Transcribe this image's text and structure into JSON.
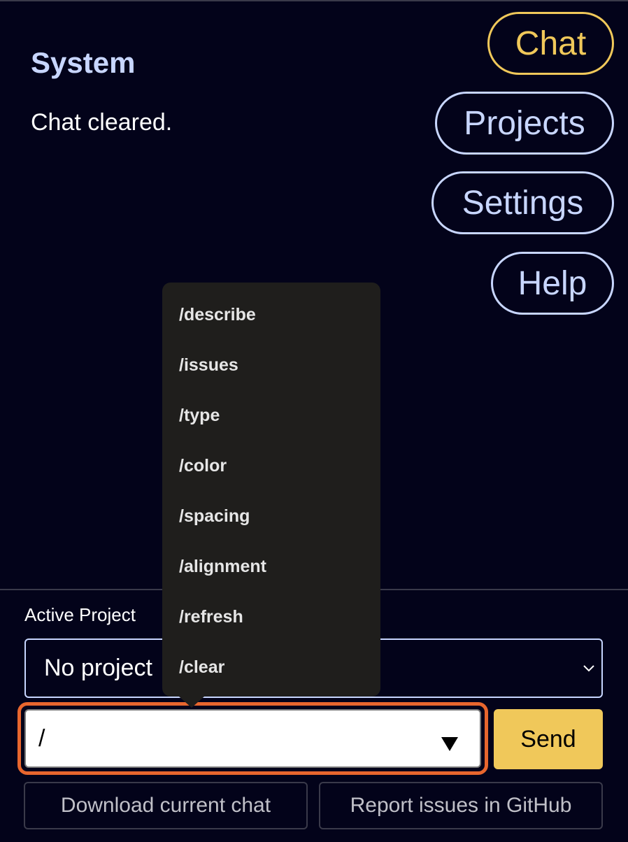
{
  "message": {
    "author": "System",
    "text": "Chat cleared."
  },
  "nav": {
    "chat": "Chat",
    "projects": "Projects",
    "settings": "Settings",
    "help": "Help",
    "active": "chat"
  },
  "project": {
    "label": "Active Project",
    "selected": "No project"
  },
  "input": {
    "value": "/"
  },
  "send_label": "Send",
  "footer": {
    "download": "Download current chat",
    "report": "Report issues in GitHub"
  },
  "commands": [
    "/describe",
    "/issues",
    "/type",
    "/color",
    "/spacing",
    "/alignment",
    "/refresh",
    "/clear"
  ],
  "colors": {
    "background": "#03031a",
    "accent": "#f0c85a",
    "nav_border": "#c8d6ff",
    "focus_ring": "#e8662e",
    "dropdown_bg": "#1f1e1c"
  }
}
